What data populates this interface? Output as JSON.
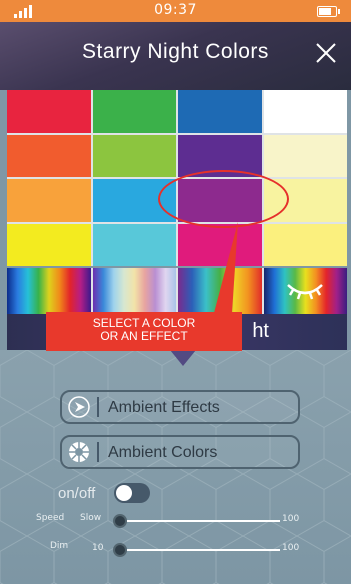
{
  "status": {
    "time": "09:37"
  },
  "header": {
    "title": "Starry Night Colors",
    "close_icon": "close-icon"
  },
  "colors": [
    "#e8243f",
    "#3bb14a",
    "#1e6ab4",
    "#ffffff",
    "#f15c2e",
    "#8cc53f",
    "#5d2d91",
    "#f8f4c9",
    "#f8a23b",
    "#29a8df",
    "#8d2a8e",
    "#f8f3a0",
    "#f3eb1f",
    "#58c8d9",
    "#e01b7c",
    "#fbf07e"
  ],
  "effects": [
    "spectrum-effect",
    "pastel-effect",
    "rainbow-effect",
    "hidden-effect-eye"
  ],
  "night_label": "ht",
  "tooltip": {
    "line1": "SELECT A COLOR",
    "line2": "OR AN EFFECT"
  },
  "buttons": {
    "ambient_effects": "Ambient Effects",
    "ambient_colors": "Ambient Colors"
  },
  "onoff_label": "on/off",
  "sliders": {
    "speed": {
      "label": "Speed",
      "min_label": "Slow",
      "max_label": "100",
      "value": 0
    },
    "dim": {
      "label": "Dim",
      "min_label": "10",
      "max_label": "100",
      "value": 0
    }
  },
  "accent_colors": {
    "status_bar": "#ee8a3c",
    "tooltip": "#e8392c"
  }
}
